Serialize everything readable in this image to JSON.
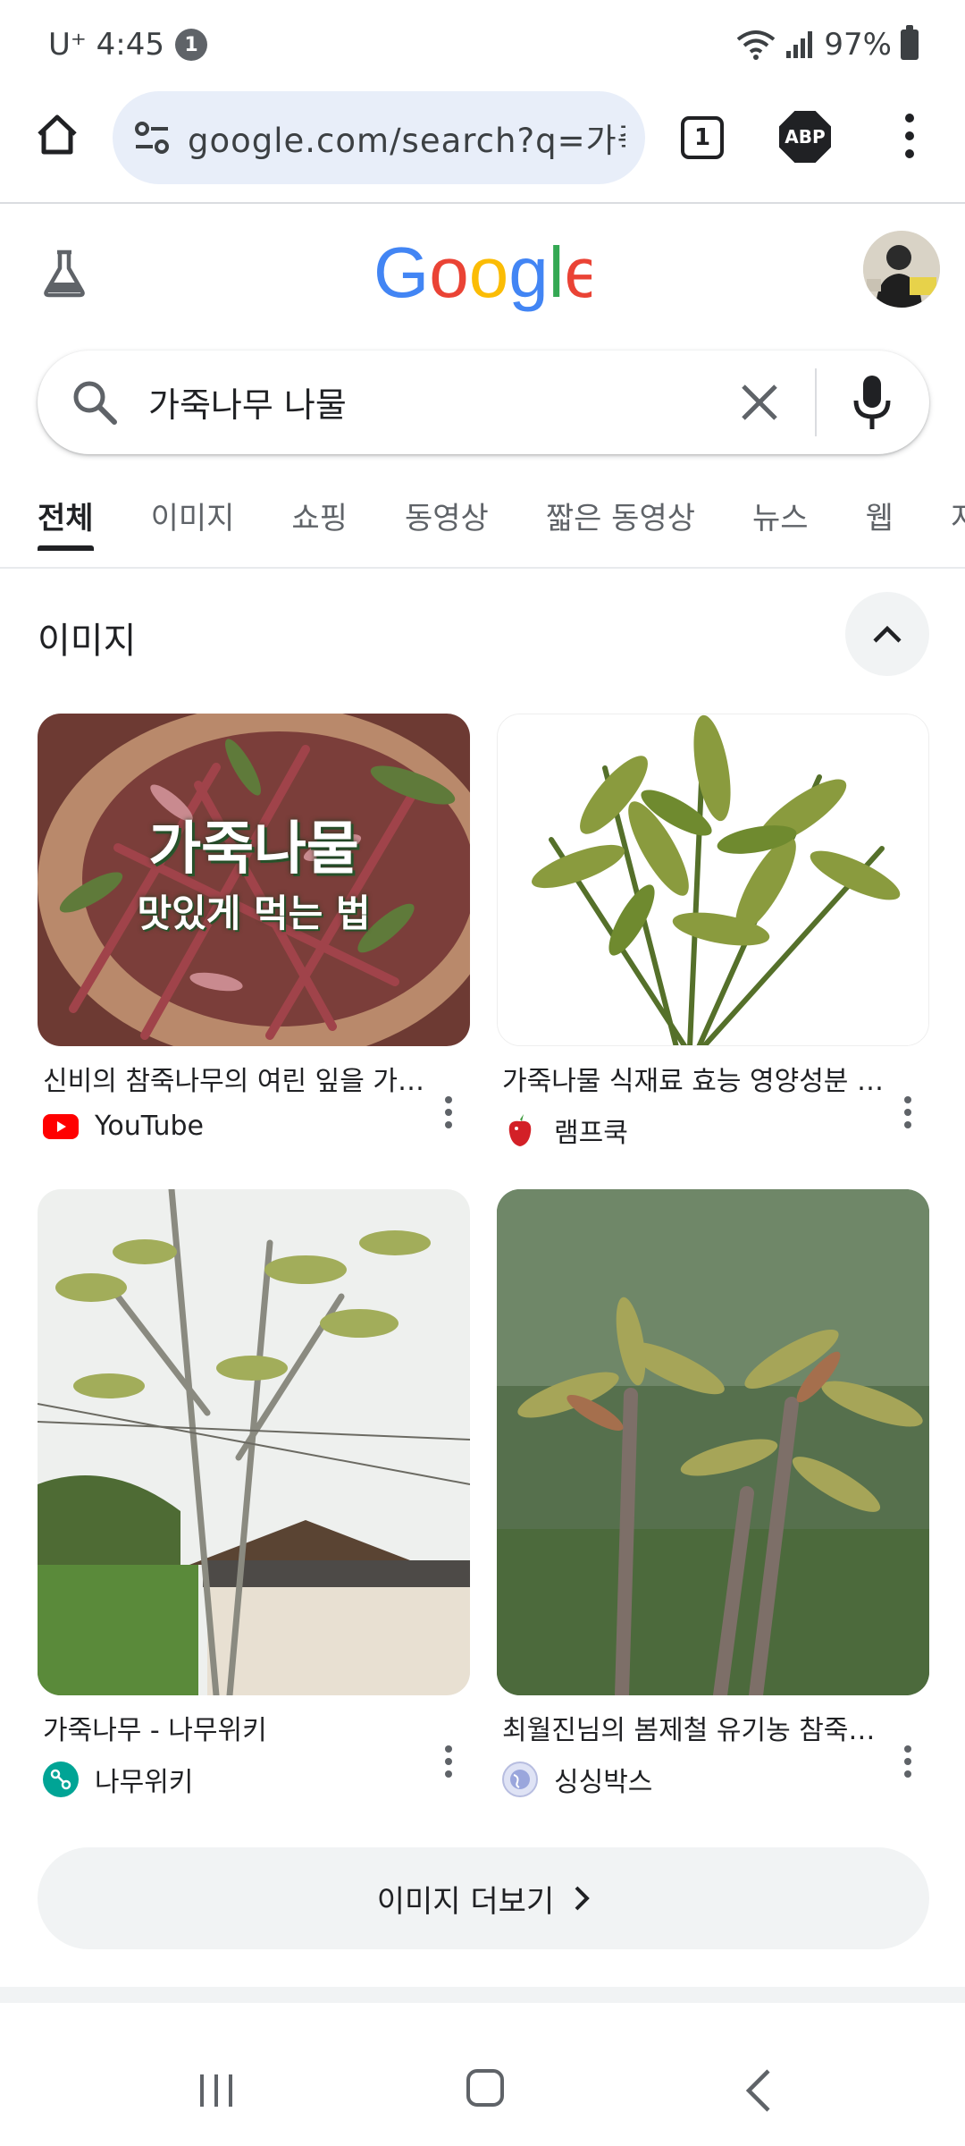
{
  "status_bar": {
    "carrier_time": "U⁺ 4:45",
    "notification_count": "1",
    "battery": "97%"
  },
  "browser": {
    "url": "google.com/search?q=가죽나무",
    "tab_count": "1",
    "adblock_label": "ABP"
  },
  "search": {
    "query": "가죽나무 나물"
  },
  "tabs": [
    "전체",
    "이미지",
    "쇼핑",
    "동영상",
    "짧은 동영상",
    "뉴스",
    "웹",
    "지"
  ],
  "images_section": {
    "title": "이미지",
    "results": [
      {
        "title": "신비의 참죽나무의 여린 잎을 가죽나물로 맛있게 먹는 법",
        "source": "YouTube",
        "overlay_line1": "가죽나물",
        "overlay_line2": "맛있게 먹는 법"
      },
      {
        "title": "가죽나물 식재료 효능 영양성분 고르는 법",
        "source": "램프쿡"
      },
      {
        "title": "가죽나무 - 나무위키",
        "source": "나무위키"
      },
      {
        "title": "최월진님의 봄제철 유기농 참죽나물 ...",
        "source": "싱싱박스"
      }
    ],
    "more_label": "이미지 더보기"
  },
  "colors": {
    "google_blue": "#4285F4",
    "google_red": "#EA4335",
    "google_yellow": "#FBBC05",
    "google_green": "#34A853",
    "url_bar_bg": "#e8eef9",
    "chip_bg": "#f1f3f4"
  }
}
